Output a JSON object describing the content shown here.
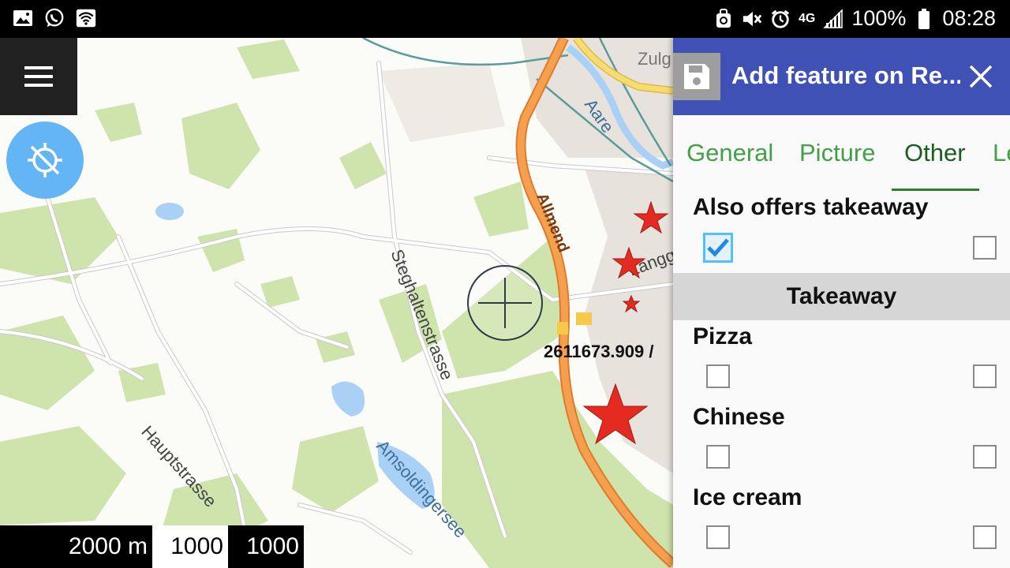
{
  "status_bar": {
    "battery_percent": "100%",
    "time": "08:28",
    "network": "4G",
    "left_icons": [
      "gallery-icon",
      "whatsapp-icon",
      "wifi-icon"
    ],
    "right_icons": [
      "sync-icon",
      "mute-icon",
      "alarm-icon",
      "network-icon",
      "signal-icon",
      "battery-icon"
    ]
  },
  "map": {
    "labels": {
      "zulg": "Zulg",
      "aare": "Aare",
      "allmend": "Allmend",
      "laengg": "Längg",
      "steghaltenstrasse": "Steghaltenstrasse",
      "hauptstrasse": "Hauptstrasse",
      "amsoldingersee": "Amsoldingersee"
    },
    "coordinate_readout": "2611673.909 / ",
    "scale_bar": {
      "seg1": "2000 m",
      "seg2": "1000",
      "seg3": "1000"
    },
    "colors": {
      "route": "#f28c38",
      "marker": "#e32b22",
      "water": "#a9d0f5",
      "vegetation": "#cfe3ad"
    }
  },
  "panel": {
    "title": "Add feature on Re...",
    "tabs": [
      {
        "label": "General",
        "active": false
      },
      {
        "label": "Picture",
        "active": false
      },
      {
        "label": "Other",
        "active": true
      },
      {
        "label": "Le",
        "active": false
      }
    ],
    "fields": [
      {
        "label": "Also offers takeaway",
        "checked_left": true,
        "checked_right": false
      }
    ],
    "section": "Takeaway",
    "takeaway_items": [
      {
        "label": "Pizza",
        "checked_left": false,
        "checked_right": false
      },
      {
        "label": "Chinese",
        "checked_left": false,
        "checked_right": false
      },
      {
        "label": "Ice cream",
        "checked_left": false,
        "checked_right": false
      }
    ],
    "colors": {
      "header": "#3f51b5",
      "tab_text": "#43a047",
      "tab_active": "#1b5e20",
      "checkbox_checked": "#4fc3f7"
    }
  }
}
